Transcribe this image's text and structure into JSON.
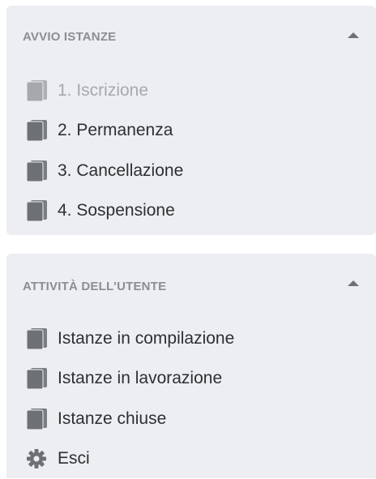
{
  "panels": [
    {
      "title": "AVVIO ISTANZE",
      "items": [
        {
          "label": "1. Iscrizione",
          "icon": "document-icon",
          "disabled": true
        },
        {
          "label": "2. Permanenza",
          "icon": "document-icon",
          "disabled": false
        },
        {
          "label": "3. Cancellazione",
          "icon": "document-icon",
          "disabled": false
        },
        {
          "label": "4. Sospensione",
          "icon": "document-icon",
          "disabled": false
        }
      ]
    },
    {
      "title": "ATTIVITÀ DELL'UTENTE",
      "items": [
        {
          "label": "Istanze in compilazione",
          "icon": "document-icon"
        },
        {
          "label": "Istanze in lavorazione",
          "icon": "document-icon"
        },
        {
          "label": "Istanze chiuse",
          "icon": "document-icon"
        },
        {
          "label": "Esci",
          "icon": "gear-icon"
        }
      ]
    }
  ],
  "colors": {
    "panel_bg": "#eceef1",
    "header_text": "#8a8e94",
    "item_text": "#2e2f32",
    "disabled_text": "#a6a9ad",
    "icon_color": "#6d7075"
  }
}
